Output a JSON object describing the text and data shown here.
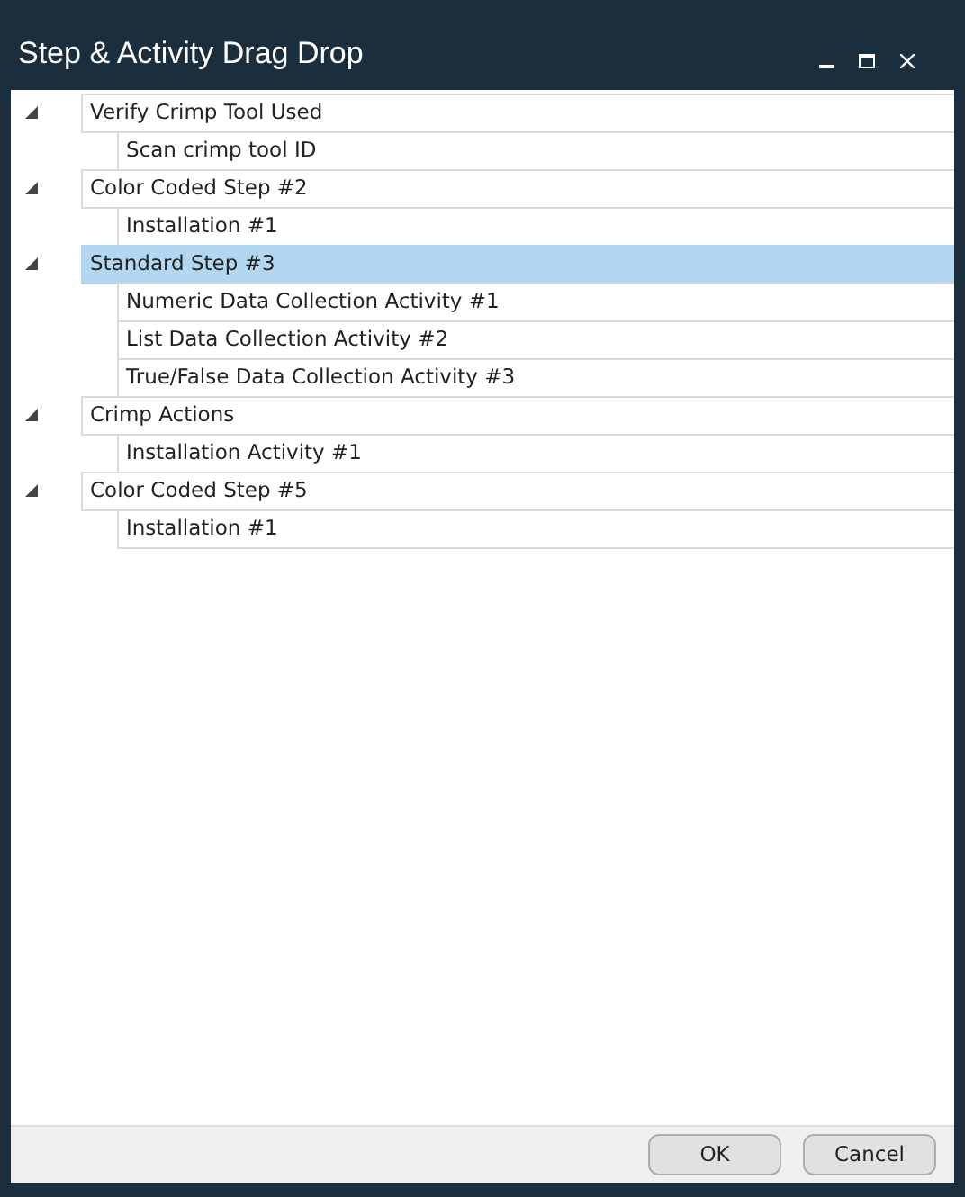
{
  "window": {
    "title": "Step & Activity Drag Drop"
  },
  "tree": [
    {
      "label": "Verify Crimp Tool Used",
      "expanded": true,
      "selected": false,
      "children": [
        {
          "label": "Scan crimp tool ID",
          "selected": false
        }
      ]
    },
    {
      "label": "Color Coded Step #2",
      "expanded": true,
      "selected": false,
      "children": [
        {
          "label": "Installation #1",
          "selected": false
        }
      ]
    },
    {
      "label": "Standard Step #3",
      "expanded": true,
      "selected": true,
      "children": [
        {
          "label": "Numeric Data Collection Activity #1",
          "selected": false
        },
        {
          "label": "List Data Collection Activity #2",
          "selected": false
        },
        {
          "label": "True/False Data Collection Activity #3",
          "selected": false
        }
      ]
    },
    {
      "label": "Crimp Actions",
      "expanded": true,
      "selected": false,
      "children": [
        {
          "label": "Installation Activity #1",
          "selected": false
        }
      ]
    },
    {
      "label": "Color Coded Step #5",
      "expanded": true,
      "selected": false,
      "children": [
        {
          "label": "Installation #1",
          "selected": false
        }
      ]
    }
  ],
  "buttons": [
    "OK",
    "Cancel"
  ]
}
